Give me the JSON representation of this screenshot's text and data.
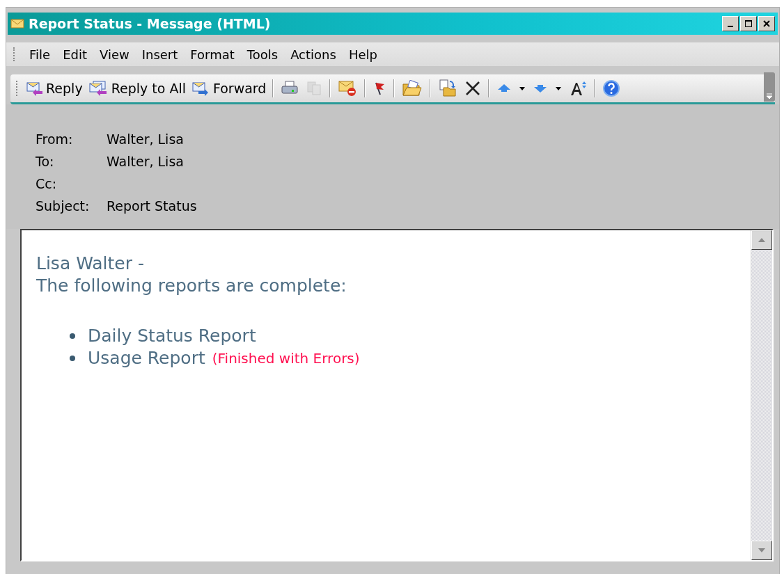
{
  "window": {
    "title": "Report Status - Message (HTML)"
  },
  "menu": [
    "File",
    "Edit",
    "View",
    "Insert",
    "Format",
    "Tools",
    "Actions",
    "Help"
  ],
  "toolbar": [
    {
      "kind": "reply",
      "label": "Reply",
      "disabled": false
    },
    {
      "kind": "reply-all",
      "label": "Reply to All",
      "disabled": false
    },
    {
      "kind": "forward",
      "label": "Forward",
      "disabled": false
    },
    {
      "kind": "separator"
    },
    {
      "kind": "print",
      "disabled": false
    },
    {
      "kind": "copy",
      "disabled": true
    },
    {
      "kind": "separator"
    },
    {
      "kind": "junk",
      "disabled": false
    },
    {
      "kind": "separator"
    },
    {
      "kind": "flag",
      "disabled": false
    },
    {
      "kind": "separator"
    },
    {
      "kind": "open-folder",
      "disabled": false
    },
    {
      "kind": "separator"
    },
    {
      "kind": "move",
      "disabled": false
    },
    {
      "kind": "delete",
      "disabled": false
    },
    {
      "kind": "separator"
    },
    {
      "kind": "previous",
      "disabled": false
    },
    {
      "kind": "dropdown",
      "disabled": false
    },
    {
      "kind": "next",
      "disabled": false
    },
    {
      "kind": "dropdown",
      "disabled": false
    },
    {
      "kind": "font-size",
      "disabled": false
    },
    {
      "kind": "separator"
    },
    {
      "kind": "help",
      "disabled": false
    }
  ],
  "header": [
    {
      "label": "From:",
      "value": "Walter, Lisa"
    },
    {
      "label": "To:",
      "value": "Walter, Lisa"
    },
    {
      "label": "Cc:"
    },
    {
      "label": "Subject:",
      "value": "Report Status"
    }
  ],
  "body": {
    "lines": [
      "Lisa Walter -",
      "The following reports are complete:"
    ],
    "items": [
      {
        "text": "Daily Status Report"
      },
      {
        "text": "Usage Report",
        "note": "(Finished with Errors)"
      }
    ]
  }
}
